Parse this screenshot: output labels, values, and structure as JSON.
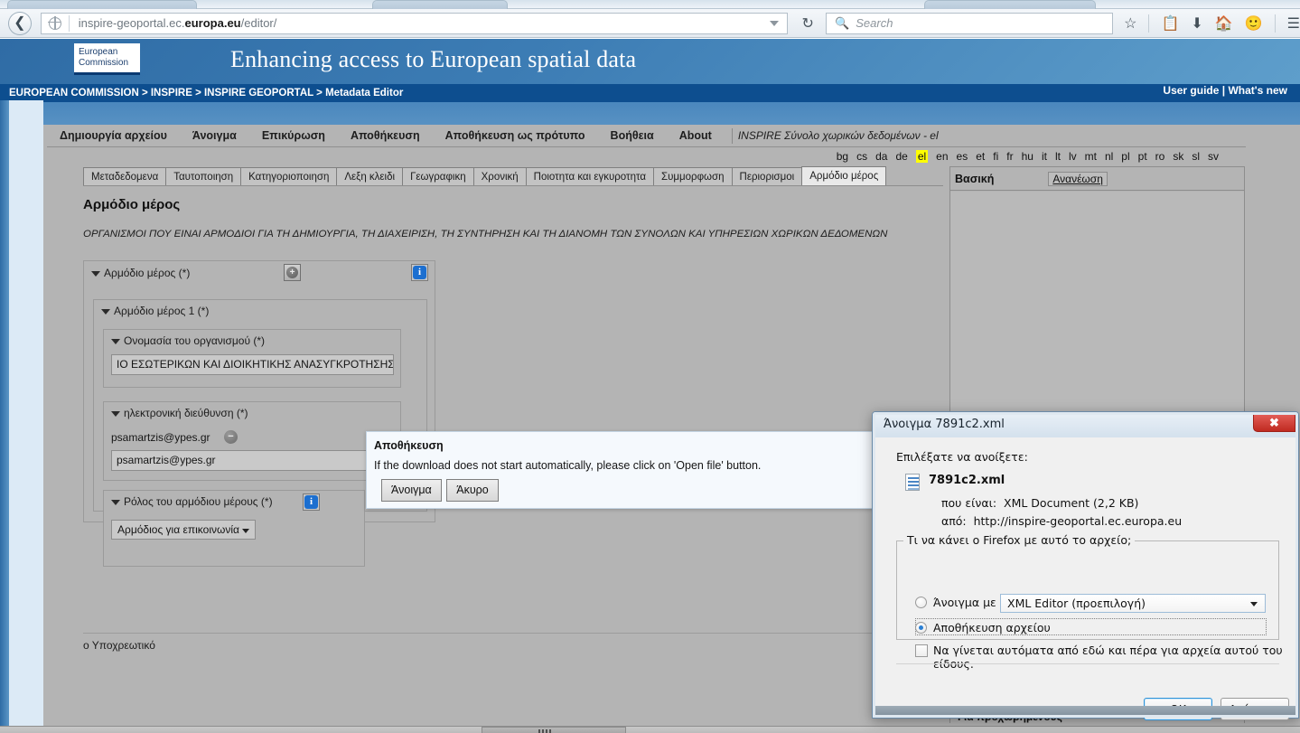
{
  "browser": {
    "url_prefix": "inspire-geoportal.ec.",
    "url_bold": "europa.eu",
    "url_suffix": "/editor/",
    "search_placeholder": "Search",
    "back_icon": "back-arrow-icon",
    "reload_icon": "reload-icon",
    "star_icon": "bookmark-star-icon",
    "library_icon": "library-icon",
    "download_icon": "downloads-icon",
    "home_icon": "home-icon",
    "sync_icon": "sync-smiley-icon",
    "menu_icon": "hamburger-menu-icon"
  },
  "site": {
    "logo_line1": "European",
    "logo_line2": "Commission",
    "banner_title": "Enhancing access to European spatial data",
    "breadcrumb": "EUROPEAN COMMISSION > INSPIRE > INSPIRE GEOPORTAL > Metadata Editor",
    "user_guide": "User guide",
    "links_separator": "|",
    "whats_new": "What's new"
  },
  "menubar": {
    "items": [
      "Δημιουργία αρχείου",
      "Άνοιγμα",
      "Επικύρωση",
      "Αποθήκευση",
      "Αποθήκευση ως πρότυπο",
      "Βοήθεια",
      "About"
    ],
    "document_title": "INSPIRE Σύνολο χωρικών δεδομένων - el"
  },
  "languages": {
    "codes": [
      "bg",
      "cs",
      "da",
      "de",
      "el",
      "en",
      "es",
      "et",
      "fi",
      "fr",
      "hu",
      "it",
      "lt",
      "lv",
      "mt",
      "nl",
      "pl",
      "pt",
      "ro",
      "sk",
      "sl",
      "sv"
    ],
    "active": "el"
  },
  "tabs": {
    "items": [
      "Μεταδεδομενα",
      "Ταυτοποιηση",
      "Κατηγοριοποιηση",
      "Λεξη κλειδι",
      "Γεωγραφικη",
      "Χρονική",
      "Ποιοτητα και εγκυροτητα",
      "Συμμορφωση",
      "Περιορισμοι",
      "Αρμόδιο μέρος"
    ],
    "active": "Αρμόδιο μέρος"
  },
  "panel": {
    "title": "Αρμόδιο μέρος",
    "description": "ΟΡΓΑΝΙΣΜΟΙ ΠΟΥ ΕΙΝΑΙ ΑΡΜΟΔΙΟΙ ΓΙΑ ΤΗ ΔΗΜΙΟΥΡΓΙΑ, ΤΗ ΔΙΑΧΕΙΡΙΣΗ, ΤΗ ΣΥΝΤΗΡΗΣΗ ΚΑΙ ΤΗ ΔΙΑΝΟΜΗ ΤΩΝ ΣΥΝΟΛΩΝ ΚΑΙ ΥΠΗΡΕΣΙΩΝ ΧΩΡΙΚΩΝ ΔΕΔΟΜΕΝΩΝ",
    "group_root_label": "Αρμόδιο μέρος (*)",
    "group_1_label": "Αρμόδιο μέρος 1 (*)",
    "org_name_label": "Ονομασία του οργανισμού (*)",
    "org_name_value": "ΙΟ ΕΣΩΤΕΡΙΚΩΝ ΚΑΙ ΔΙΟΙΚΗΤΙΚΗΣ ΑΝΑΣΥΓΚΡΟΤΗΣΗΣ",
    "email_label": "ηλεκτρονική διεύθυνση (*)",
    "email_existing": "psamartzis@ypes.gr",
    "email_new_value": "psamartzis@ypes.gr",
    "role_label": "Ρόλος του αρμόδιου μέρους (*)",
    "role_value": "Αρμόδιος για επικοινωνία",
    "footnote": "ο Υποχρεωτικό",
    "add_icon": "add-circle-icon",
    "remove_icon": "remove-circle-icon",
    "info_icon": "info-icon"
  },
  "preview": {
    "title": "Βασική",
    "refresh": "Ανανέωση",
    "advanced": "Για προχωρημένους"
  },
  "save_dialog": {
    "title": "Αποθήκευση",
    "message": "If the download does not start automatically, please click on 'Open file' button.",
    "open_button": "Άνοιγμα",
    "cancel_button": "Άκυρο"
  },
  "firefox_dialog": {
    "title": "Άνοιγμα 7891c2.xml",
    "close_icon": "close-x-icon",
    "lead": "Επιλέξατε να ανοίξετε:",
    "file_icon": "xml-file-icon",
    "file_name": "7891c2.xml",
    "type_key": "που είναι:",
    "type_value": "XML Document (2,2 KB)",
    "from_key": "από:",
    "from_value": "http://inspire-geoportal.ec.europa.eu",
    "group_legend": "Τι να κάνει ο Firefox  με αυτό το αρχείο;",
    "open_with_label_a": "Άν",
    "open_with_label_u": "ο",
    "open_with_label_b": "ιγμα με",
    "open_with_full": "Άνοιγμα με",
    "combo_value": "XML Editor (προεπιλογή)",
    "save_file_full": "Αποθήκευση αρχείου",
    "save_file_a": "Αποθήκευ",
    "save_file_u": "σ",
    "save_file_b": "η αρχείου",
    "auto_label": "Να γίνεται αυτόματα από εδώ και πέρα για αρχεία αυτού του είδους.",
    "ok_button": "OK",
    "cancel_button": "Ακύρωση",
    "selected_option": "Αποθήκευση αρχείου"
  },
  "colors": {
    "ec_blue": "#2f6ca5",
    "breadcrumb_blue": "#0d4e8f",
    "highlight_yellow": "#ffff00",
    "app_gray": "#b4b4b4",
    "info_blue": "#1c6fd0"
  }
}
